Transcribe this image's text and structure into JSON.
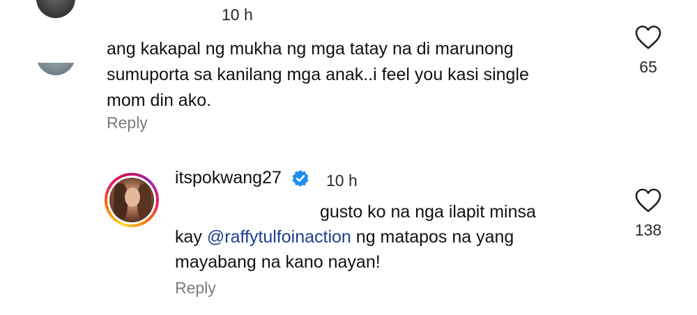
{
  "comments": [
    {
      "time": "10 h",
      "text": "ang kakapal ng mukha ng mga tatay na di marunong sumuporta sa kanilang mga anak..i feel you kasi single mom din ako.",
      "text_lines": [
        "ang kakapal ng mukha ng mga tatay na di marunong",
        "sumuporta sa kanilang mga anak..i feel you kasi single",
        "mom din ako."
      ],
      "reply_label": "Reply",
      "likes": "65",
      "like_icon": "heart-outline-icon"
    },
    {
      "username": "itspokwang27",
      "verified_icon": "verified-badge-icon",
      "time": "10 h",
      "text_line1": "gusto ko na nga ilapit minsa",
      "text_line2_prefix": "kay ",
      "mention": "@raffytulfoinaction",
      "text_line2_suffix": " ng matapos na yang",
      "text_line3": "mayabang na kano nayan!",
      "reply_label": "Reply",
      "likes": "138",
      "like_icon": "heart-outline-icon"
    }
  ],
  "colors": {
    "mention": "#1c3f8f",
    "verified": "#1d8cf0",
    "reply": "#7b7b7b",
    "story_ring_start": "#fdd835",
    "story_ring_end": "#e91e63"
  }
}
